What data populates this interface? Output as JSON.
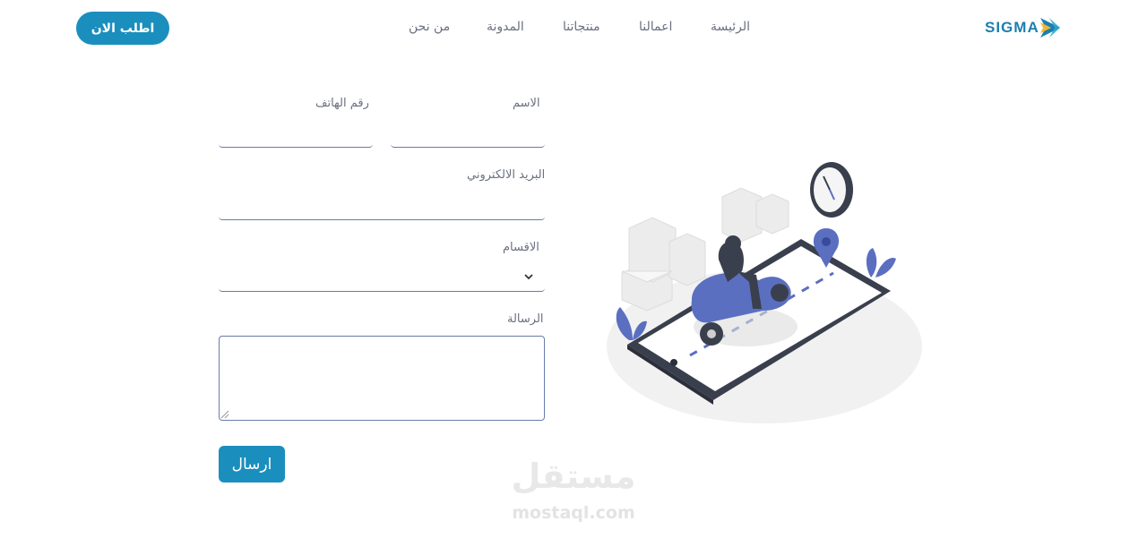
{
  "header": {
    "order_button": "اطلب الان",
    "nav": [
      "الرئيسة",
      "اعمالنا",
      "منتجاتنا",
      "المدونة",
      "من نحن"
    ],
    "logo_text": "SIGMA",
    "logo_icon": "double-chevron-logo-icon"
  },
  "form": {
    "name_label": "الاسم",
    "name_value": "",
    "phone_label": "رقم الهاتف",
    "phone_value": "",
    "email_label": "البريد الالكتروني",
    "email_value": "",
    "category_label": "الاقسام",
    "category_value": "",
    "message_label": "الرسالة",
    "message_value": "",
    "submit_label": "ارسال"
  },
  "illustration": {
    "description_icon": "delivery-scooter-phone-illustration"
  },
  "watermark": {
    "arabic": "مستقل",
    "latin": "mostaql.com"
  },
  "colors": {
    "accent": "#1a8fbd",
    "input_border": "#6a7ba8",
    "illustration_blue": "#5b6fc0",
    "dark": "#3a3f4d"
  }
}
